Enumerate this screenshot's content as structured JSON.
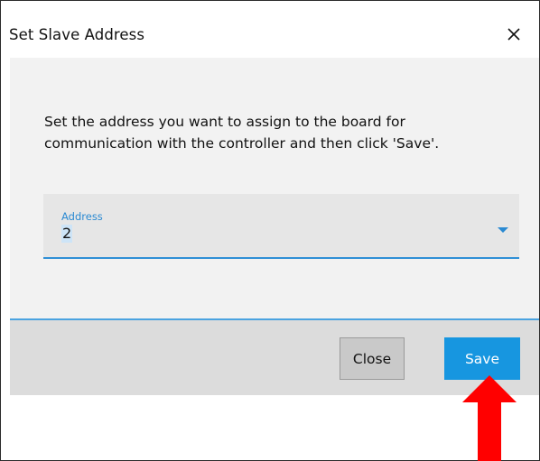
{
  "dialog": {
    "title": "Set Slave Address",
    "close_icon": "close-icon"
  },
  "content": {
    "instructions": "Set the address you want to assign to the board for communication with the controller and then click 'Save'.",
    "address_field": {
      "label": "Address",
      "value": "2",
      "dropdown_icon": "chevron-down-icon"
    }
  },
  "footer": {
    "close_label": "Close",
    "save_label": "Save"
  },
  "annotation": {
    "arrow_icon": "arrow-up-icon",
    "arrow_color": "#ff0000"
  },
  "colors": {
    "accent": "#1796e0",
    "field_underline": "#2f8fd6",
    "content_bg": "#f2f2f2",
    "footer_bg": "#dcdcdc"
  }
}
